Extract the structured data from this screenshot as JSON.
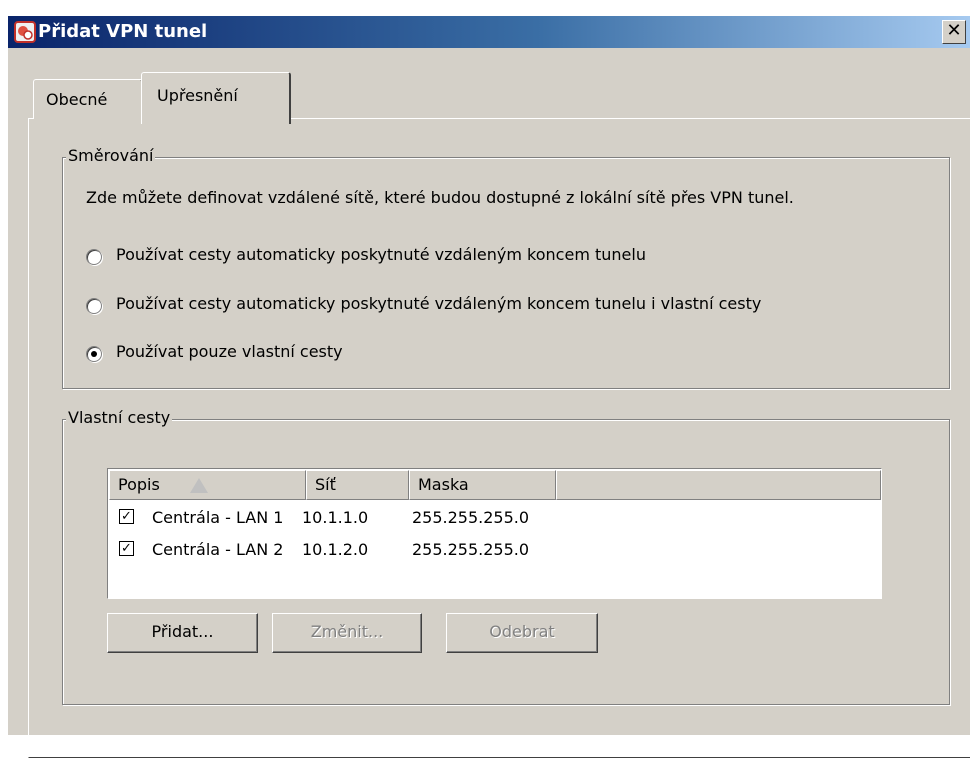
{
  "window": {
    "title": "Přidat VPN tunel",
    "close_glyph": "✕"
  },
  "tabs": [
    {
      "label": "Obecné",
      "selected": false
    },
    {
      "label": "Upřesnění",
      "selected": true
    }
  ],
  "routing": {
    "legend": "Směrování",
    "description": "Zde můžete definovat vzdálené sítě, které budou dostupné z lokální sítě přes VPN tunel.",
    "options": [
      {
        "label": "Používat cesty automaticky poskytnuté vzdáleným koncem tunelu",
        "selected": false
      },
      {
        "label": "Používat cesty automaticky poskytnuté vzdáleným koncem tunelu i vlastní cesty",
        "selected": false
      },
      {
        "label": "Používat pouze vlastní cesty",
        "selected": true
      }
    ]
  },
  "custom_routes": {
    "legend": "Vlastní cesty",
    "columns": [
      {
        "label": "Popis",
        "sorted": "ascending"
      },
      {
        "label": "Síť"
      },
      {
        "label": "Maska"
      },
      {
        "label": ""
      }
    ],
    "rows": [
      {
        "checked": true,
        "description": "Centrála - LAN 1",
        "network": "10.1.1.0",
        "mask": "255.255.255.0"
      },
      {
        "checked": true,
        "description": "Centrála - LAN 2",
        "network": "10.1.2.0",
        "mask": "255.255.255.0"
      }
    ],
    "buttons": {
      "add": "Přidat...",
      "edit": "Změnit...",
      "remove": "Odebrat"
    },
    "buttons_enabled": {
      "add": true,
      "edit": false,
      "remove": false
    }
  },
  "colors": {
    "titlebar_start": "#0a246a",
    "titlebar_end": "#a6caf0",
    "dialog_face": "#d4d0c8"
  }
}
